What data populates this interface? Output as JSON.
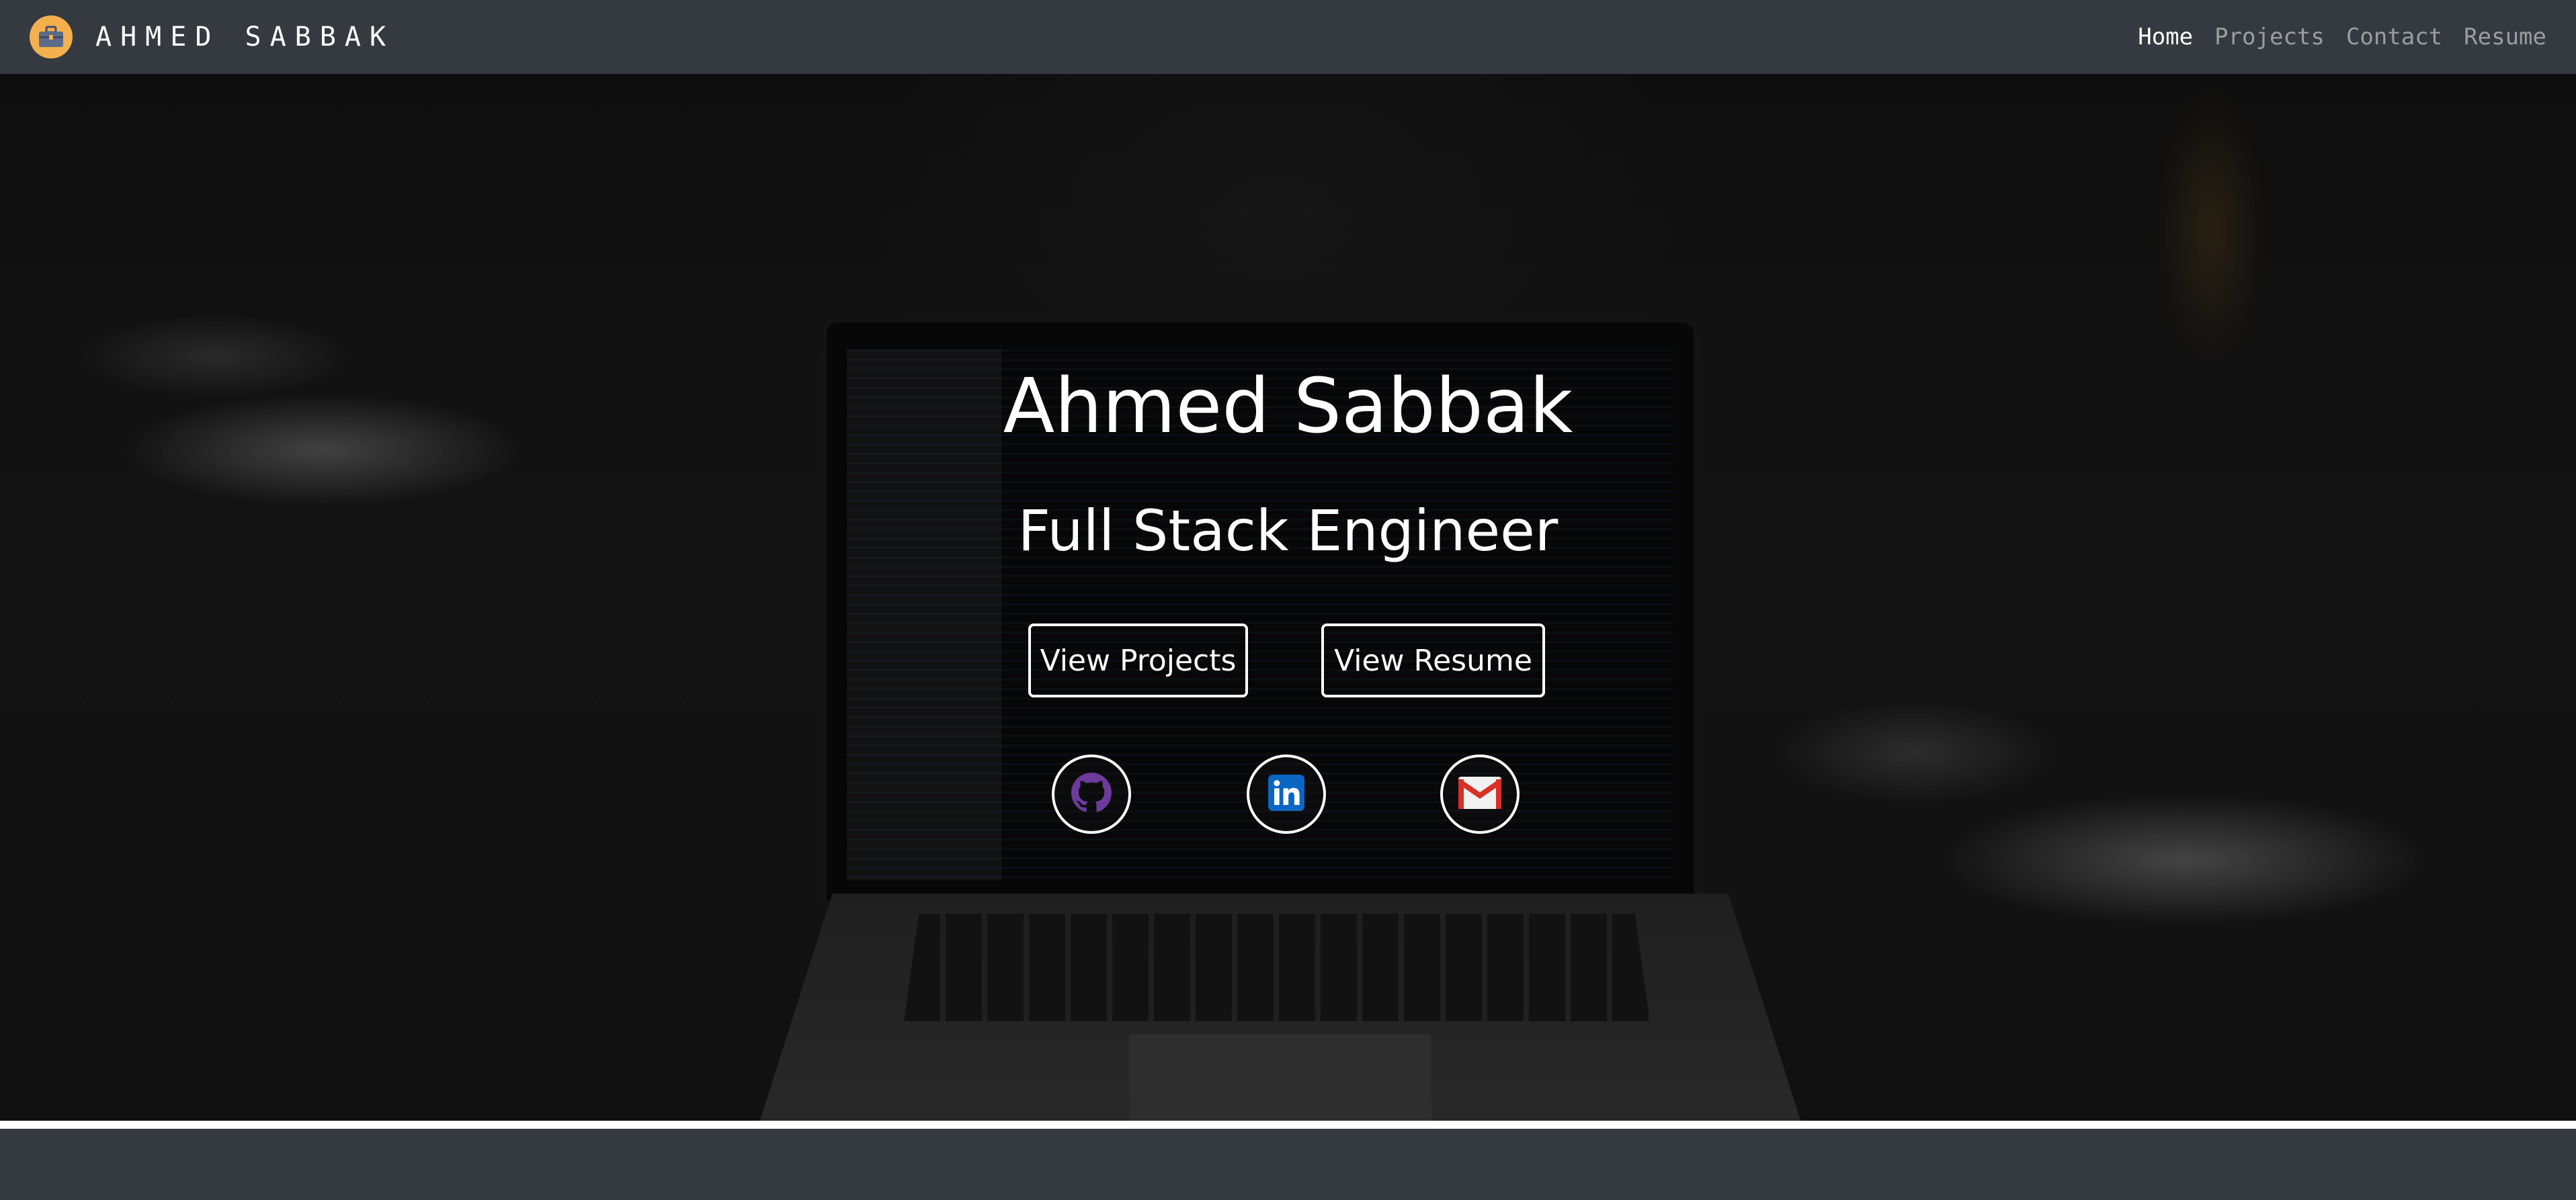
{
  "navbar": {
    "brand": "AHMED SABBAK",
    "logo_icon": "briefcase-icon",
    "logo_color": "#f4b04e",
    "links": [
      {
        "label": "Home",
        "active": true
      },
      {
        "label": "Projects",
        "active": false
      },
      {
        "label": "Contact",
        "active": false
      },
      {
        "label": "Resume",
        "active": false
      }
    ]
  },
  "hero": {
    "title": "Ahmed Sabbak",
    "subtitle": "Full Stack Engineer",
    "buttons": {
      "projects": "View Projects",
      "resume": "View Resume"
    },
    "social": [
      {
        "icon": "github-icon",
        "color": "#6e3a9b"
      },
      {
        "icon": "linkedin-icon",
        "color": "#0a66c2"
      },
      {
        "icon": "gmail-icon",
        "color": "#d93025"
      }
    ]
  }
}
